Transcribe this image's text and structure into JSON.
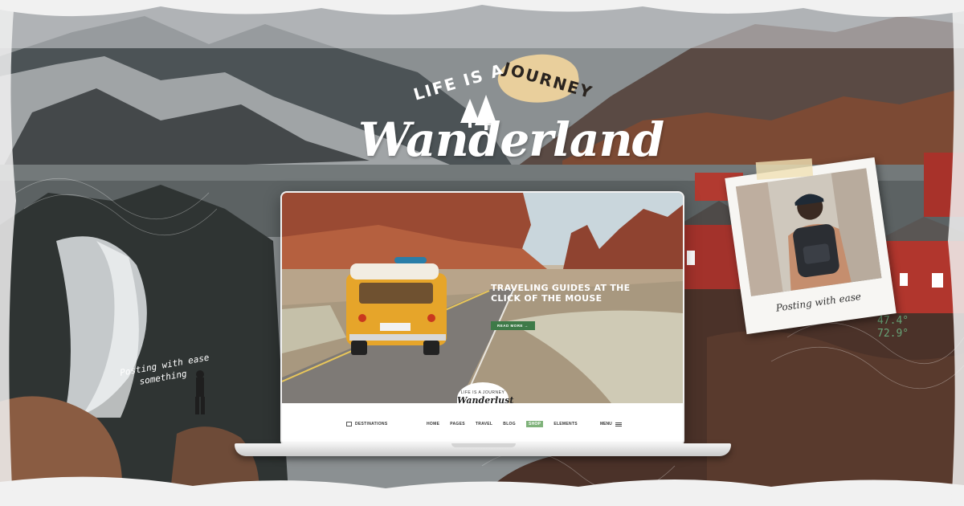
{
  "brand": {
    "tagline_start": "LIFE IS A",
    "tagline_accent": "JOURNEY",
    "name": "Wanderland"
  },
  "overlays": {
    "left_caption_line1": "Posting with ease",
    "left_caption_line2": "something",
    "polaroid_caption": "Posting with ease",
    "coords_line1": "47.4°",
    "coords_line2": "72.9°"
  },
  "laptop": {
    "hero": {
      "title": "TRAVELING GUIDES AT THE CLICK OF THE MOUSE",
      "button": "READ MORE →"
    },
    "logo": {
      "small": "LIFE IS A JOURNEY",
      "name": "Wanderlust"
    },
    "nav": {
      "destinations": "DESTINATIONS",
      "items": [
        "HOME",
        "PAGES",
        "TRAVEL",
        "BLOG",
        "SHOP",
        "ELEMENTS"
      ],
      "active_index": 4,
      "menu": "MENU"
    }
  },
  "colors": {
    "accent_green": "#3e7a48",
    "nav_active": "#7fb27a",
    "van_yellow": "#e6a52a",
    "sand_blob": "#e9cf9c"
  }
}
